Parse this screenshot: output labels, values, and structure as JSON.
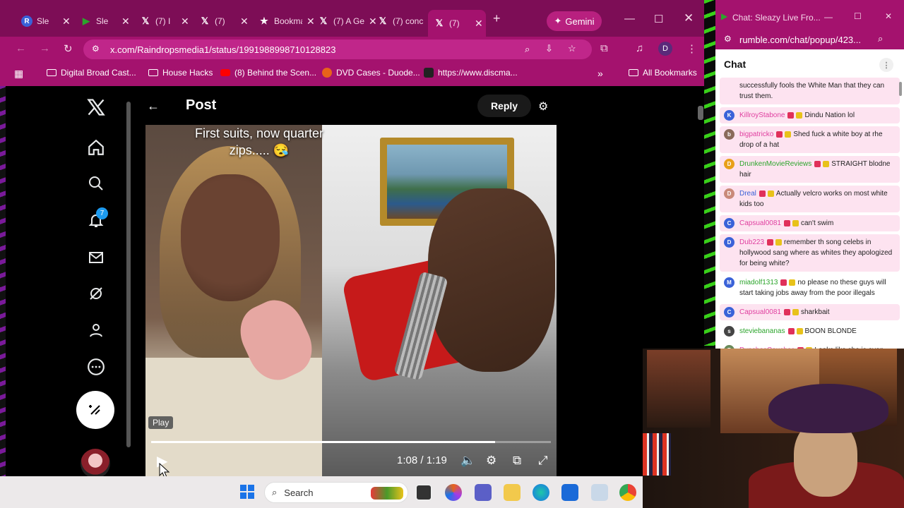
{
  "browser": {
    "tabs": [
      {
        "label": "Sle",
        "icon": "rumble-icon",
        "color": "#3a62d8",
        "glyph": "R"
      },
      {
        "label": "Sle",
        "icon": "rumble-play-icon",
        "color": "#2ca52c",
        "glyph": "▶"
      },
      {
        "label": "(7) I",
        "icon": "x-icon",
        "color": "#000000",
        "glyph": "X"
      },
      {
        "label": "(7)",
        "icon": "x-icon",
        "color": "#000000",
        "glyph": "X"
      },
      {
        "label": "Bookma",
        "icon": "star-icon",
        "color": "#000000",
        "glyph": "★"
      },
      {
        "label": "(7) A Ge",
        "icon": "x-icon",
        "color": "#000000",
        "glyph": "X"
      },
      {
        "label": "(7) conc",
        "icon": "x-icon",
        "color": "#000000",
        "glyph": "X"
      },
      {
        "label": "(7)",
        "icon": "x-icon",
        "color": "#000000",
        "glyph": "X"
      }
    ],
    "gemini_label": "Gemini",
    "url": "x.com/Raindropsmedia1/status/1991988998710128823",
    "profile_initial": "D",
    "bookmarks": [
      {
        "label": "Digital Broad Cast...",
        "icon": "folder-icon"
      },
      {
        "label": "House Hacks",
        "icon": "folder-icon"
      },
      {
        "label": "(8) Behind the Scen...",
        "icon": "youtube-icon"
      },
      {
        "label": "DVD Cases - Duode...",
        "icon": "site-icon"
      },
      {
        "label": "https://www.discma...",
        "icon": "site-icon"
      }
    ],
    "all_bookmarks": "All Bookmarks"
  },
  "x": {
    "notification_count": "7",
    "post_title": "Post",
    "reply_label": "Reply",
    "video": {
      "caption": "First suits, now quarter zips..... 😪",
      "play_tooltip": "Play",
      "time": "1:08 / 1:19",
      "progress": 0.86
    }
  },
  "taskbar": {
    "search_placeholder": "Search"
  },
  "chat": {
    "window_title": "Chat: Sleazy Live Fro...",
    "url": "rumble.com/chat/popup/423...",
    "header": "Chat",
    "messages": [
      {
        "user": "",
        "text": "successfully fools the White Man that they can trust them.",
        "avatar": "",
        "avcolor": "#ffffff",
        "hl": true,
        "ucls": ""
      },
      {
        "user": "KillroyStabone",
        "text": "Dindu Nation lol",
        "avatar": "K",
        "avcolor": "#3a62d8",
        "hl": true,
        "ucls": ""
      },
      {
        "user": "bigpatricko",
        "text": "Shed fuck a white boy at rhe drop of a hat",
        "avatar": "b",
        "avcolor": "#8a6a5a",
        "hl": true,
        "ucls": ""
      },
      {
        "user": "DrunkenMovieReviews",
        "text": "STRAIGHT blodne hair",
        "avatar": "D",
        "avcolor": "#e8a01a",
        "hl": true,
        "ucls": "g"
      },
      {
        "user": "Dreal",
        "text": "Actually velcro works on most white kids too",
        "avatar": "D",
        "avcolor": "#c98a7a",
        "hl": true,
        "ucls": "b"
      },
      {
        "user": "Capsual0081",
        "text": "can't swim",
        "avatar": "C",
        "avcolor": "#3a62d8",
        "hl": true,
        "ucls": ""
      },
      {
        "user": "Dub223",
        "text": "remember th song celebs in hollywood sang where as whites they apologized for being white?",
        "avatar": "D",
        "avcolor": "#3a62d8",
        "hl": true,
        "ucls": ""
      },
      {
        "user": "miadolf1313",
        "text": "no please no these guys will start taking jobs away from the poor illegals",
        "avatar": "M",
        "avcolor": "#3a62d8",
        "hl": false,
        "ucls": "g"
      },
      {
        "user": "Capsual0081",
        "text": "sharkbait",
        "avatar": "C",
        "avcolor": "#3a62d8",
        "hl": true,
        "ucls": ""
      },
      {
        "user": "steviebananas",
        "text": "BOON BLONDE",
        "avatar": "s",
        "avcolor": "#444444",
        "hl": false,
        "ucls": "g"
      },
      {
        "user": "PunchesCouches",
        "text": "Looks like she is even putting a light makeup on too",
        "avatar": "P",
        "avcolor": "#6a8a5a",
        "hl": false,
        "ucls": ""
      }
    ]
  }
}
